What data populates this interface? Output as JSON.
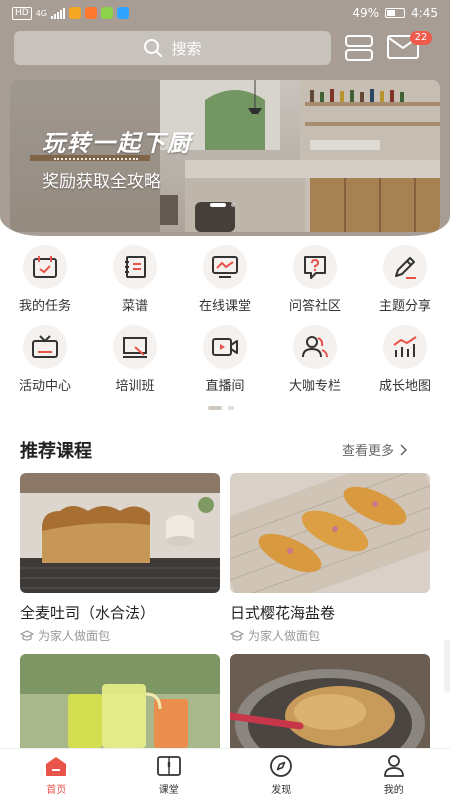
{
  "status_bar": {
    "network": "HD",
    "signal": "4G",
    "battery": "49%",
    "time": "4:45"
  },
  "header": {
    "search_placeholder": "搜索",
    "message_badge": "22"
  },
  "banner": {
    "title": "玩转一起下厨",
    "subtitle": "奖励获取全攻略"
  },
  "menu": {
    "items": [
      {
        "label": "我的任务",
        "icon": "task-calendar-icon"
      },
      {
        "label": "菜谱",
        "icon": "recipe-book-icon"
      },
      {
        "label": "在线课堂",
        "icon": "online-class-icon"
      },
      {
        "label": "问答社区",
        "icon": "qa-community-icon"
      },
      {
        "label": "主题分享",
        "icon": "pencil-share-icon"
      },
      {
        "label": "活动中心",
        "icon": "activity-tv-icon"
      },
      {
        "label": "培训班",
        "icon": "training-board-icon"
      },
      {
        "label": "直播间",
        "icon": "live-camera-icon"
      },
      {
        "label": "大咖专栏",
        "icon": "expert-column-icon"
      },
      {
        "label": "成长地图",
        "icon": "growth-chart-icon"
      }
    ]
  },
  "recommend": {
    "title": "推荐课程",
    "more_label": "查看更多",
    "courses": [
      {
        "title": "全麦吐司（水合法）",
        "subtitle": "为家人做面包"
      },
      {
        "title": "日式樱花海盐卷",
        "subtitle": "为家人做面包"
      }
    ]
  },
  "tabbar": {
    "tabs": [
      {
        "label": "首页",
        "icon": "home-icon",
        "active": true
      },
      {
        "label": "课堂",
        "icon": "classroom-book-icon",
        "active": false
      },
      {
        "label": "发现",
        "icon": "compass-icon",
        "active": false
      },
      {
        "label": "我的",
        "icon": "profile-icon",
        "active": false
      }
    ]
  },
  "colors": {
    "accent": "#e8534a",
    "header_bg": "#a79d94"
  }
}
